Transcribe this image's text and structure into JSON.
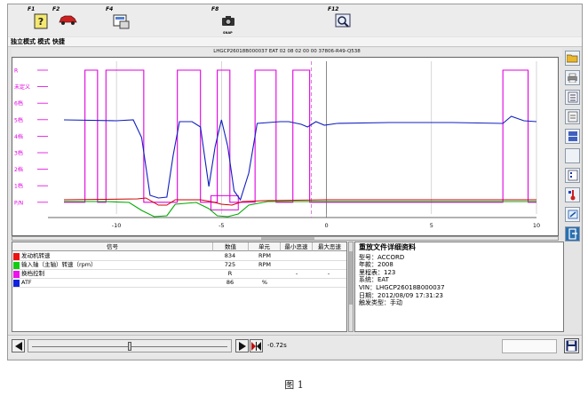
{
  "fkeys": [
    {
      "label": "F1",
      "icon": "help-icon"
    },
    {
      "label": "F2",
      "icon": "car-icon"
    },
    {
      "label": "F4",
      "icon": "print-preview-icon"
    },
    {
      "label": "F8",
      "icon": "snapshot-camera-icon"
    },
    {
      "label": "F12",
      "icon": "zoom-search-icon"
    }
  ],
  "fkey_snap_text": "SNAP",
  "menu_text": "独立模式 模式 快捷",
  "vin_bar": "LHGCP26018B000037  EAT  02 08 02 00 00  37806-R49-Q538",
  "plot": {
    "y_labels": [
      "R",
      "未定义",
      "6档",
      "5档",
      "4档",
      "3档",
      "2档",
      "1档",
      "P/N"
    ],
    "x_ticks": [
      "-10",
      "-5",
      "0",
      "5",
      "10"
    ],
    "x_range": [
      -12.5,
      10
    ],
    "colors": {
      "engine": "#cc0000",
      "input_shaft": "#00aa00",
      "gear": "#e000e0",
      "atf": "#1020c0",
      "grid": "#888888"
    }
  },
  "table": {
    "headers": [
      "信号",
      "数值",
      "单元",
      "最小恶速",
      "最大恶速"
    ],
    "rows": [
      {
        "name": "发动机转速",
        "value": "834",
        "unit": "RPM",
        "min": "",
        "max": "",
        "color": "#ee1111"
      },
      {
        "name": "输入轴（主轴）转速（rpm）",
        "value": "725",
        "unit": "RPM",
        "min": "",
        "max": "",
        "color": "#11cc11"
      },
      {
        "name": "换档控制",
        "value": "R",
        "unit": "",
        "min": "-",
        "max": "-",
        "color": "#ee11ee"
      },
      {
        "name": "ATF",
        "value": "86",
        "unit": "%",
        "min": "",
        "max": "",
        "color": "#1122dd"
      }
    ]
  },
  "info": {
    "title": "重放文件详细资料",
    "lines": [
      "型号：ACCORD",
      "年款：2008",
      "里程表：123",
      "系统：EAT",
      "VIN：LHGCP26018B000037",
      "日期：2012/08/09 17:31:23",
      "触发类型：手动"
    ]
  },
  "playback": {
    "time": "-0.72s"
  },
  "caption": "图 1"
}
